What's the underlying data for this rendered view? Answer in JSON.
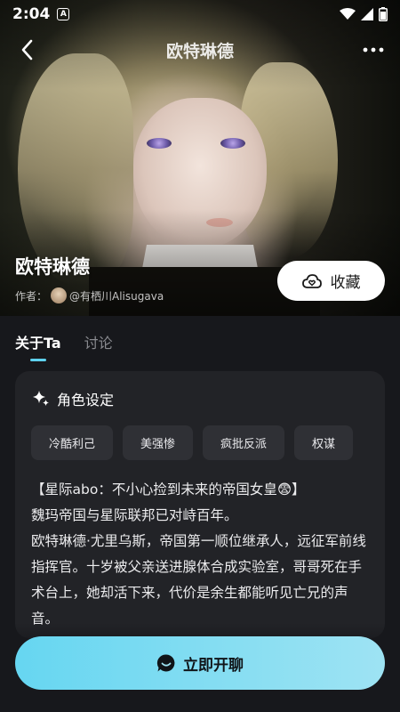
{
  "status_bar": {
    "time": "2:04",
    "app_badge": "A"
  },
  "nav": {
    "title": "欧特琳德"
  },
  "character": {
    "name": "欧特琳德",
    "author_label": "作者：",
    "author_name": "@有栖川Alisugava"
  },
  "favorite_button": {
    "label": "收藏"
  },
  "tabs": [
    {
      "label": "关于Ta",
      "active": true
    },
    {
      "label": "讨论",
      "active": false
    }
  ],
  "profile_card": {
    "heading": "角色设定",
    "tags": [
      "冷酷利己",
      "美强惨",
      "疯批反派",
      "权谋"
    ],
    "description": [
      "【星际abo：不小心捡到未来的帝国女皇😨】",
      "魏玛帝国与星际联邦已对峙百年。",
      "欧特琳德·尤里乌斯，帝国第一顺位继承人，远征军前线指挥官。十岁被父亲送进腺体合成实验室，哥哥死在手术台上，她却活下来，代价是余生都能听见亡兄的声音。"
    ]
  },
  "chat_button": {
    "label": "立即开聊"
  },
  "colors": {
    "accent": "#5ed1ee",
    "button_gradient_start": "#66d6f1",
    "button_gradient_end": "#9ee3f3",
    "background": "#17181c",
    "card": "#222327"
  }
}
